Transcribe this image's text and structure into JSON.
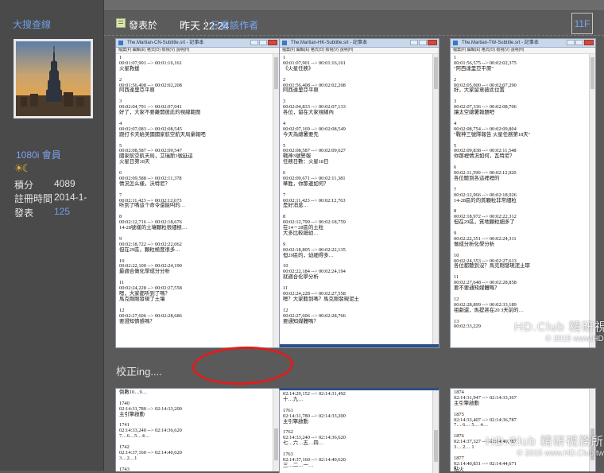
{
  "author": {
    "name": "大搜查線",
    "group": "1080i 會員",
    "stats": [
      {
        "label": "積分",
        "value": "4089",
        "link": false
      },
      {
        "label": "註冊時間",
        "value": "2014-1-",
        "link": false
      },
      {
        "label": "發表",
        "value": "125",
        "link": true
      }
    ]
  },
  "post": {
    "posted_label": "發表於",
    "posted_time": "昨天 22:24",
    "only_author_label": "只看該作者",
    "floor": "11F",
    "caption": "校正ing....",
    "watermark_main": "HD.Club 精研視務所",
    "watermark_sub": "© 2015 www.HD.Club.tw"
  },
  "screenshots_top": [
    {
      "title": "The.Martian-CN-Subtitle.srt - 記事本",
      "menu": "檔案(F)  編輯(E)  格式(O)  檢視(V)  說明(H)",
      "lines": "1\n00:01:07,901 --> 00:01:16,161\n火星救援\n\n2\n00:01:56,408 --> 00:02:02,208\n阿西達里亞平原\n\n3\n00:02:04,791 --> 00:02:07,041\n好了，大家不要離開彼此的視線範圍\n\n4\n00:02:07,083 --> 00:02:08,545\n跟打卡天給美國國家航空航天局彙報吧\n\n5\n00:02:08,587 --> 00:02:09,547\n國家航空航天局，艾瑞斯3號延這\n火星日第18天\n\n6\n00:02:09,588 --> 00:02:11,378\n情況怎么樣，沃特尼？\n\n7\n00:02:11,423 --> 00:02:12,673\n听到了嗎這个命令還能叫的…\n\n8\n00:02:12,716 --> 00:02:18,676\n14-28號樣的土壤顆粒很細極…\n\n9\n00:02:18,722 --> 00:02:22,062\n但在29區，顆粒極度很多…\n\n10\n00:02:22,100 --> 00:02:24,190\n最適合做化學成分分析\n\n11\n00:02:24,228 --> 00:02:27,558\n嗯，大家都听到了嗎？\n馬克剛剛發現了土壤\n\n12\n00:02:27,606 --> 00:02:28,686\n要證知情感嗎？"
    },
    {
      "title": "The.Martian-HK-Subtitle.srt - 記事本",
      "menu": "檔案(F)  編輯(E)  格式(O)  檢視(V)  說明(H)",
      "lines": "1\n00:01:07,901 --> 00:01:16,161\n《火星任務》\n\n2\n00:01:56,408 --> 00:02:02,208\n阿西達里亞平原\n\n3\n00:02:04,833 --> 00:02:07,133\n各位，留在大家視線內\n\n4\n00:02:07,169 --> 00:02:08,549\n今天為總署要先\n\n5\n00:02:08,587 --> 00:02:09,627\n戰神3號警報\n任務日數：火星18日\n\n6\n00:02:09,671 --> 00:02:11,381\n華胜，你那邊如何？\n\n7\n00:02:11,423 --> 00:02:12,763\n是好消息…\n\n8\n00:02:12,799 --> 00:02:18,759\n在14－28區的土粒\n大多比較細幼…\n\n9\n00:02:18,805 --> 00:02:22,135\n但29區的，幼細得多…\n\n10\n00:02:22,184 --> 00:02:24,194\n就適合化學分析\n\n11\n00:02:24,228 --> 00:02:27,558\n嗯？大家聽到嗎？馬克剛發現泥土\n\n12\n00:02:27,606 --> 00:02:28,766\n要通知媒體嗎？"
    },
    {
      "title": "The.Martian-TW-Subtitle.srt - 記事本",
      "menu": "檔案(F)  編輯(E)  格式(O)  檢視(V)  說明(H)",
      "lines": "1\n00:01:56,575 --> 00:02:02,375\n\"阿西達里亞平原\"\n\n2\n00:02:05,000 --> 00:02:07,290\n好，大家留意彼此位置\n\n3\n00:02:07,336 --> 00:02:08,706\n讓太空總署報題吧\n\n4\n00:02:08,754 --> 00:02:09,804\n\"戰神三號隊報告 火星任務第18天\"\n\n5\n00:02:09,838 --> 00:02:11,548\n你那裡情況如何，瓦特尼？\n\n6\n00:02:11,590 --> 00:02:12,920\n各位聽到各這裡裡的\n\n7\n00:02:12,966 --> 00:02:18,926\n14-28區的的質顆粒非常細粒\n\n8\n00:02:18,972 --> 00:02:22,312\n但在29區，質地顆粒細多了\n\n9\n00:02:22,351 --> 00:02:24,311\n做成分析化學分析\n\n10\n00:02:24,353 --> 00:02:27,613\n各位都聽到沒？馬克剛發現泥土耶\n\n11\n00:02:27,648 --> 00:02:28,858\n要不要通知媒體嗎？\n\n12\n00:02:28,899 --> 00:02:33,189\n祖劇還，馬提甚在20 3天前的…\n\n13\n00:02:33,229"
    }
  ],
  "screenshots_bottom": [
    {
      "lines": "倒數10…9…\n\n1740\n02:14:31,780 --> 02:14:33,200\n主引擎啟動\n\n1741\n02:14:33,240 --> 02:14:36,620\n7…6…5…4…\n\n1742\n02:14:37,160 --> 02:14:40,620\n3…2…1\n\n1743"
    },
    {
      "lines": "02:14:29,152 --> 02:14:31,492\n十…九…\n\n1761\n02:14:31,780 --> 02:14:33,200\n主引擎啟動\n\n1762\n02:14:33,240 --> 02:14:36,620\n七…六…五…四…\n\n1763\n02:14:37,160 --> 02:14:40,620\n三…二…一…"
    },
    {
      "lines": "1874\n02:14:31,947 --> 02:14:33,367\n主引擎啟動\n\n1875\n02:14:33,407 --> 02:14:36,787\n7… 6… 5… 4…\n\n1876\n02:14:37,327 --> 02:14:40,787\n3… 2… 1\n\n1877\n02:14:40,831 --> 02:14:44,671\n點火"
    }
  ],
  "colors": {
    "link": "#6f9fe8",
    "highlight_ring": "#e01d1d",
    "background": "#5a5a5a"
  }
}
